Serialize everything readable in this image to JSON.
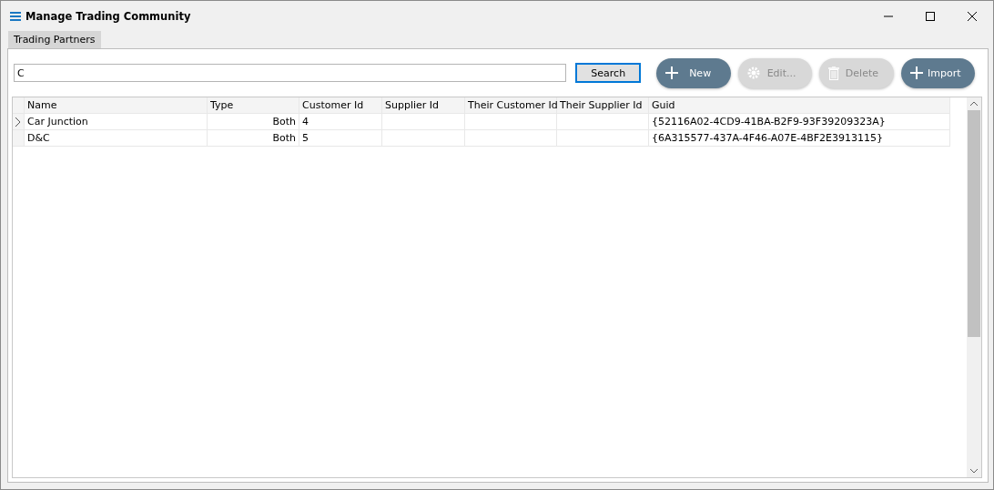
{
  "window": {
    "title": "Manage Trading Community"
  },
  "tabs": [
    {
      "label": "Trading Partners",
      "selected": true
    }
  ],
  "search": {
    "value": "C",
    "button": "Search"
  },
  "actions": [
    {
      "label": "New",
      "kind": "add",
      "disabled": false
    },
    {
      "label": "Edit...",
      "kind": "edit",
      "disabled": true
    },
    {
      "label": "Delete",
      "kind": "delete",
      "disabled": true
    },
    {
      "label": "Import",
      "kind": "add",
      "disabled": false
    }
  ],
  "table": {
    "columns": [
      "Name",
      "Type",
      "Customer Id",
      "Supplier Id",
      "Their Customer Id",
      "Their Supplier Id",
      "Guid"
    ],
    "rows": [
      {
        "current": true,
        "cells": [
          "Car Junction",
          "Both",
          "4",
          "",
          "",
          "",
          "{52116A02-4CD9-41BA-B2F9-93F39209323A}"
        ]
      },
      {
        "current": false,
        "cells": [
          "D&C",
          "Both",
          "5",
          "",
          "",
          "",
          "{6A315577-437A-4F46-A07E-4BF2E3913115}"
        ]
      }
    ]
  }
}
